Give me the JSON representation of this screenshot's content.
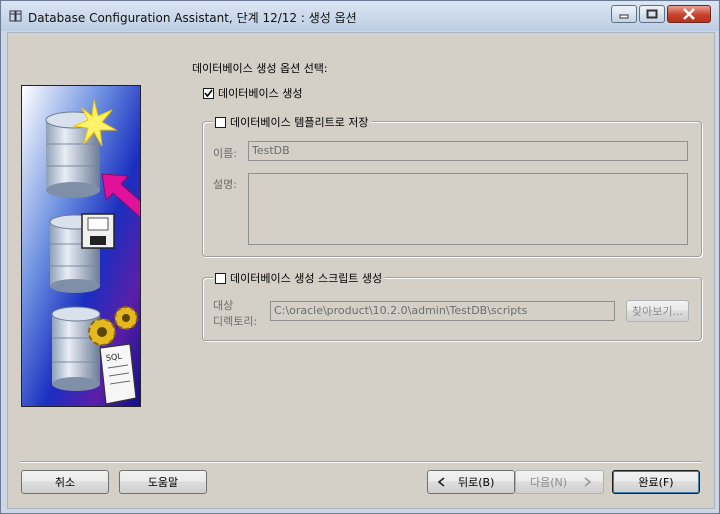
{
  "window": {
    "title": "Database Configuration Assistant, 단계 12/12 : 생성 옵션"
  },
  "heading": "데이터베이스 생성 옵션 선택:",
  "create_db": {
    "label": "데이터베이스 생성",
    "checked": true
  },
  "save_template": {
    "label": "데이터베이스 템플리트로 저장",
    "checked": false,
    "name_label": "이름:",
    "name_value": "TestDB",
    "desc_label": "설명:",
    "desc_value": ""
  },
  "generate_scripts": {
    "label": "데이터베이스 생성 스크립트 생성",
    "checked": false,
    "dest_label_1": "대상",
    "dest_label_2": "디렉토리:",
    "dest_value": "C:\\oracle\\product\\10.2.0\\admin\\TestDB\\scripts",
    "browse_label": "찾아보기..."
  },
  "buttons": {
    "cancel": "취소",
    "help": "도움말",
    "back": "뒤로(B)",
    "next": "다음(N)",
    "finish": "완료(F)"
  },
  "art": {
    "sql_label": "SQL"
  },
  "colors": {
    "accent": "#3c7fb1",
    "magenta_arrow": "#e0119a",
    "art_blue": "#1322a8"
  }
}
